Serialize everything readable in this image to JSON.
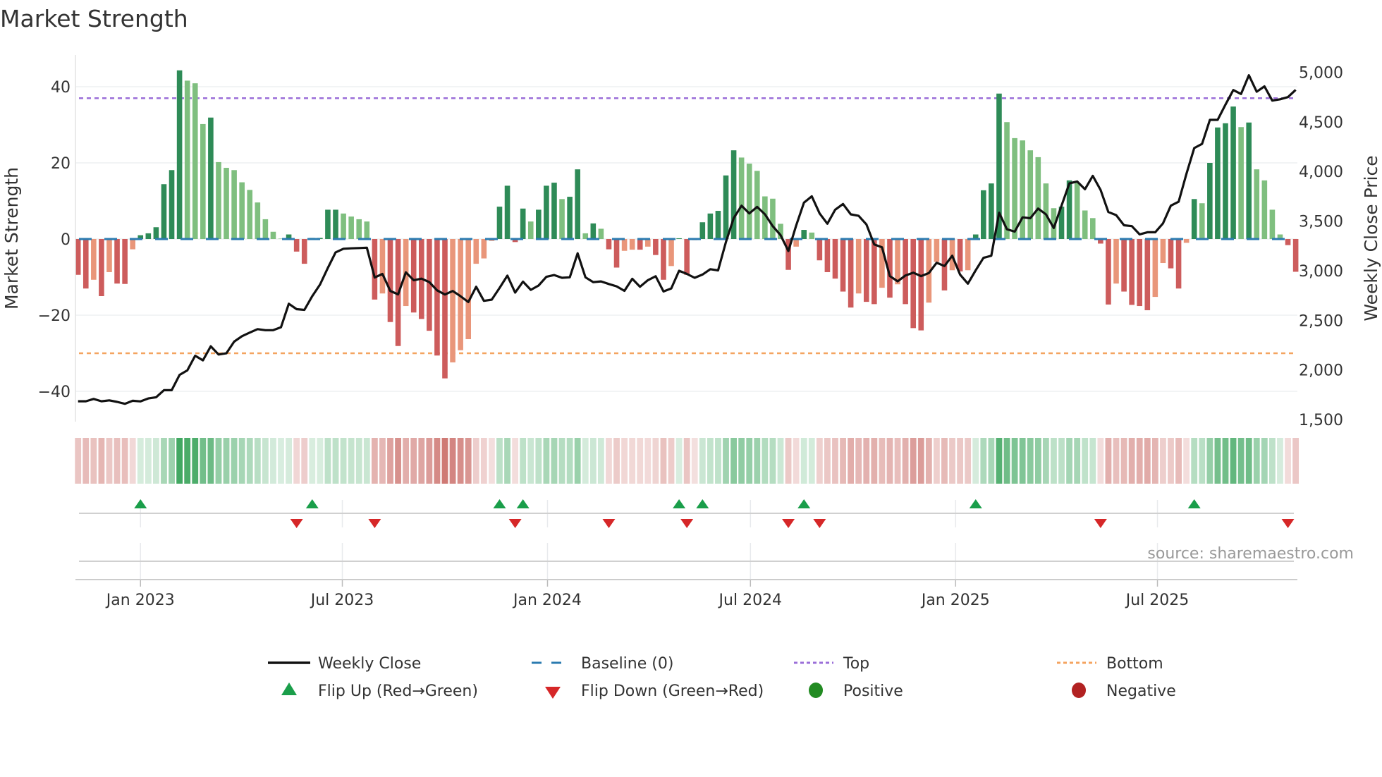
{
  "title": "Market Strength",
  "source": "source: sharemaestro.com",
  "legend": {
    "weekly_close": "Weekly Close",
    "baseline": "Baseline (0)",
    "top": "Top",
    "bottom": "Bottom",
    "flip_up": "Flip Up (Red→Green)",
    "flip_down": "Flip Down (Green→Red)",
    "positive": "Positive",
    "negative": "Negative"
  },
  "colors": {
    "strong_green": "#2e8b57",
    "weak_green": "#7fbf7f",
    "strong_red": "#cd5c5c",
    "weak_red": "#e9967a",
    "baseline": "#2b7bb0",
    "top": "#9b6fd8",
    "bottom": "#f4a460",
    "flip_up": "#1a9e4a",
    "flip_down": "#d62728",
    "positive": "#228b22",
    "negative": "#b22222",
    "close": "#111111"
  },
  "chart_data": {
    "type": "bar",
    "title": "Market Strength",
    "ylabel": "Market Strength",
    "y2label": "Weekly Close Price",
    "x_start": "2022-11-06",
    "x_step_days": 7,
    "ylim": [
      -48,
      48
    ],
    "y2lim": [
      1486,
      5160
    ],
    "yticks": [
      40,
      20,
      0,
      -20,
      -40
    ],
    "ytick_labels": [
      "40",
      "20",
      "0",
      "−20",
      "−40"
    ],
    "y2ticks": [
      5000,
      4500,
      4000,
      3500,
      3000,
      2500,
      2000,
      1500
    ],
    "y2tick_labels": [
      "5,000",
      "4,500",
      "4,000",
      "3,500",
      "3,000",
      "2,500",
      "2,000",
      "1,500"
    ],
    "xticks": [
      {
        "date": "2023-01-01",
        "label": "Jan 2023"
      },
      {
        "date": "2023-07-01",
        "label": "Jul 2023"
      },
      {
        "date": "2024-01-01",
        "label": "Jan 2024"
      },
      {
        "date": "2024-07-01",
        "label": "Jul 2024"
      },
      {
        "date": "2025-01-01",
        "label": "Jan 2025"
      },
      {
        "date": "2025-07-01",
        "label": "Jul 2025"
      }
    ],
    "baseline": 0,
    "top": 37,
    "bottom": -30,
    "strength": [
      -9.4,
      -13,
      -10.7,
      -15,
      -8.7,
      -11.7,
      -11.8,
      -2.7,
      1,
      1.5,
      3.1,
      14.4,
      18.1,
      44.3,
      41.6,
      40.9,
      30.2,
      31.9,
      20.2,
      18.7,
      18.1,
      14.9,
      12.9,
      9.6,
      5.2,
      1.9,
      0.1,
      1.2,
      -3.3,
      -6.5,
      0.3,
      0.3,
      7.7,
      7.7,
      6.7,
      5.9,
      5.2,
      4.6,
      -15.9,
      -14.3,
      -21.8,
      -28.1,
      -17.6,
      -19.3,
      -21,
      -24.1,
      -30.6,
      -36.6,
      -32.4,
      -29.2,
      -26.3,
      -6.5,
      -5.1,
      -0.5,
      8.5,
      14,
      -0.8,
      8,
      4.6,
      7.7,
      14,
      14.8,
      10.5,
      11.1,
      18.3,
      1.5,
      4.1,
      2.7,
      -2.7,
      -7.5,
      -3.1,
      -2.8,
      -2.8,
      -2,
      -4.2,
      -10.7,
      -7.1,
      0.2,
      -9.4,
      -0.3,
      4.4,
      6.7,
      7.4,
      16.7,
      23.3,
      21.4,
      19.8,
      17.9,
      11.2,
      10.6,
      4,
      -8.1,
      -2,
      2.4,
      1.7,
      -5.6,
      -8.7,
      -10.4,
      -13.8,
      -18,
      -14.3,
      -16.5,
      -17.1,
      -12.8,
      -15.4,
      -11.9,
      -17.1,
      -23.4,
      -24,
      -16.7,
      -6,
      -13.5,
      -8.2,
      -8.5,
      -8.2,
      1.2,
      12.8,
      14.6,
      38.2,
      30.7,
      26.5,
      25.9,
      23.3,
      21.5,
      14.6,
      8.1,
      8.5,
      15.4,
      14.8,
      7.5,
      5.5,
      -1.2,
      -17.2,
      -11.7,
      -13.8,
      -17.3,
      -17.6,
      -18.7,
      -15.2,
      -6.3,
      -7.7,
      -13,
      -1,
      10.5,
      9.4,
      20,
      29.3,
      30.4,
      34.8,
      29.4,
      30.6,
      18.3,
      15.4,
      7.7,
      1.2,
      -1.6,
      -8.6
    ],
    "weekly_close": [
      1684,
      1684,
      1707,
      1684,
      1693,
      1677,
      1658,
      1689,
      1682,
      1712,
      1724,
      1795,
      1795,
      1949,
      1996,
      2143,
      2096,
      2238,
      2155,
      2167,
      2285,
      2340,
      2376,
      2411,
      2400,
      2400,
      2430,
      2667,
      2612,
      2605,
      2743,
      2861,
      3027,
      3185,
      3221,
      3225,
      3228,
      3232,
      2931,
      2967,
      2796,
      2761,
      2984,
      2904,
      2920,
      2885,
      2802,
      2760,
      2795,
      2743,
      2684,
      2838,
      2696,
      2708,
      2826,
      2950,
      2779,
      2890,
      2807,
      2850,
      2938,
      2956,
      2928,
      2933,
      3175,
      2933,
      2885,
      2892,
      2866,
      2842,
      2797,
      2918,
      2838,
      2904,
      2944,
      2790,
      2821,
      2999,
      2967,
      2928,
      2961,
      3015,
      3003,
      3288,
      3530,
      3655,
      3577,
      3643,
      3568,
      3449,
      3359,
      3198,
      3454,
      3686,
      3750,
      3577,
      3473,
      3615,
      3672,
      3568,
      3553,
      3466,
      3265,
      3236,
      2945,
      2893,
      2952,
      2980,
      2945,
      2976,
      3080,
      3047,
      3151,
      2961,
      2869,
      3004,
      3129,
      3151,
      3584,
      3418,
      3394,
      3537,
      3529,
      3626,
      3568,
      3430,
      3655,
      3880,
      3899,
      3821,
      3956,
      3814,
      3591,
      3560,
      3458,
      3449,
      3366,
      3387,
      3387,
      3477,
      3655,
      3695,
      3975,
      4236,
      4278,
      4520,
      4520,
      4674,
      4821,
      4781,
      4970,
      4804,
      4858,
      4714,
      4728,
      4750,
      4823
    ]
  }
}
